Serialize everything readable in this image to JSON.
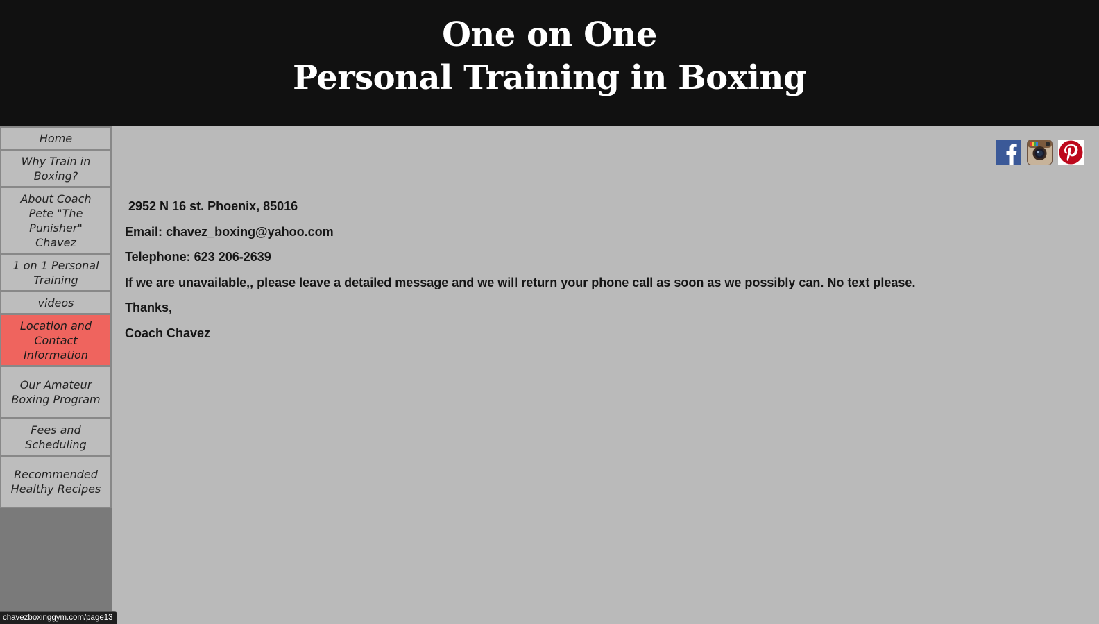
{
  "header": {
    "title_line1": "One on One",
    "title_line2": "Personal Training in Boxing"
  },
  "sidebar": {
    "items": [
      {
        "label": "Home",
        "active": false
      },
      {
        "label": "Why Train in Boxing?",
        "active": false
      },
      {
        "label": "About Coach Pete \"The Punisher\" Chavez",
        "active": false
      },
      {
        "label": "1 on 1 Personal Training",
        "active": false
      },
      {
        "label": "videos",
        "active": false
      },
      {
        "label": "Location and Contact Information",
        "active": true
      },
      {
        "label": "Our Amateur Boxing Program",
        "active": false
      },
      {
        "label": "Fees and Scheduling",
        "active": false
      },
      {
        "label": "Recommended Healthy Recipes",
        "active": false
      }
    ],
    "active_color": "#ef645e"
  },
  "social": {
    "icons": [
      "facebook-icon",
      "instagram-icon",
      "pinterest-icon"
    ],
    "colors": {
      "facebook": "#3b5998",
      "pinterest": "#bd081c"
    }
  },
  "content": {
    "address": "2952 N 16 st. Phoenix, 85016",
    "email": "Email: chavez_boxing@yahoo.com",
    "telephone": "Telephone: 623 206-2639",
    "message": "If we are unavailable,, please leave a detailed message and we will return your phone call as soon as we possibly can. No text please.",
    "thanks": "Thanks,",
    "signature": "Coach Chavez"
  },
  "status_bar": {
    "url": "chavezboxinggym.com/page13"
  }
}
